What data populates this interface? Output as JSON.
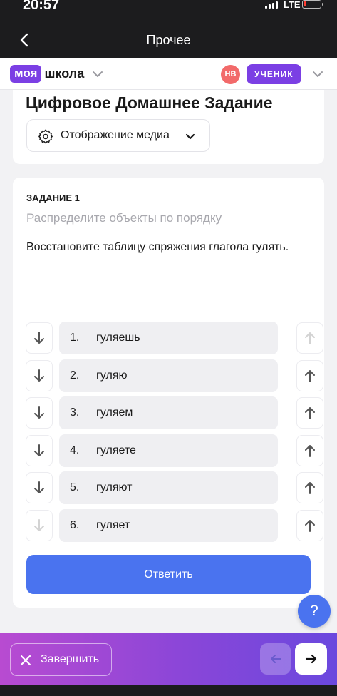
{
  "status_bar": {
    "time": "20:57",
    "network": "LTE"
  },
  "nav": {
    "title": "Прочее"
  },
  "app_header": {
    "logo_part1": "моя",
    "logo_part2": "школа",
    "user_initials": "НВ",
    "role": "УЧЕНИК"
  },
  "page": {
    "title": "Цифровое Домашнее Задание",
    "media_button": "Отображение медиа"
  },
  "task": {
    "number_label": "ЗАДАНИЕ 1",
    "hint": "Распределите объекты по порядку",
    "instruction": "Восстановите таблицу спряжения глагола гулять.",
    "items": [
      {
        "num": "1.",
        "word": "гуляешь",
        "up_enabled": false,
        "down_enabled": true
      },
      {
        "num": "2.",
        "word": "гуляю",
        "up_enabled": true,
        "down_enabled": true
      },
      {
        "num": "3.",
        "word": "гуляем",
        "up_enabled": true,
        "down_enabled": true
      },
      {
        "num": "4.",
        "word": "гуляете",
        "up_enabled": true,
        "down_enabled": true
      },
      {
        "num": "5.",
        "word": "гуляют",
        "up_enabled": true,
        "down_enabled": true
      },
      {
        "num": "6.",
        "word": "гуляет",
        "up_enabled": true,
        "down_enabled": false
      }
    ],
    "answer_button": "Ответить"
  },
  "help": {
    "label": "?"
  },
  "footer": {
    "finish_label": "Завершить"
  },
  "colors": {
    "accent_purple": "#7b3fe4",
    "button_blue": "#4a73ef",
    "avatar_red": "#f26a6a"
  },
  "icons": {
    "back": "chevron-left-icon",
    "logo_dropdown": "chevron-down-icon",
    "media": "gear-icon",
    "move_down": "arrow-down-icon",
    "move_up": "arrow-up-icon",
    "finish": "close-icon",
    "prev": "arrow-left-icon",
    "next": "arrow-right-icon"
  }
}
